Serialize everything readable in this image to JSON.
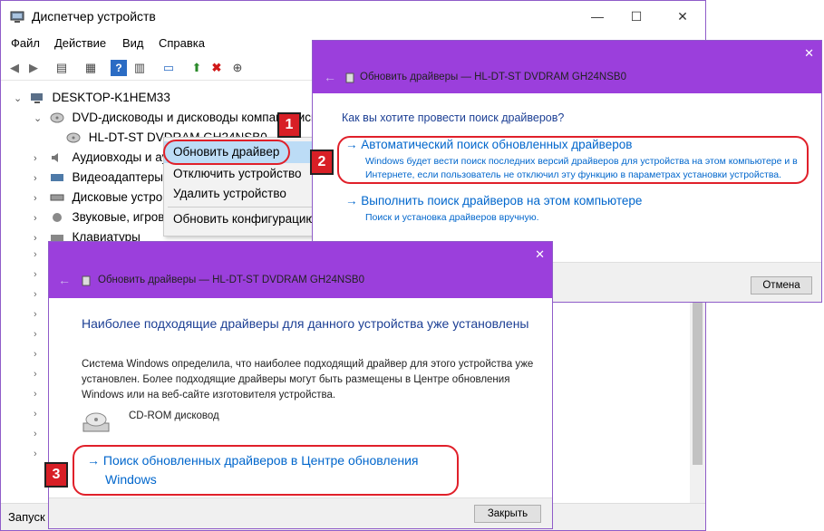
{
  "dm": {
    "title": "Диспетчер устройств",
    "minimize": "—",
    "maximize": "☐",
    "close": "✕",
    "menu": [
      "Файл",
      "Действие",
      "Вид",
      "Справка"
    ],
    "tree": {
      "root": "DESKTOP-K1HEM33",
      "dvd_category": "DVD-дисководы и дисководы компакт-дисков",
      "dvd_device": "HL-DT-ST DVDRAM GH24NSB0",
      "audio": "Аудиовходы и аудиовыходы",
      "video": "Видеоадаптеры",
      "disks": "Дисковые устройства",
      "sound": "Звуковые, игровые и видеоустройства",
      "keyboards": "Клавиатуры"
    },
    "status": "Запуск"
  },
  "context_menu": {
    "update": "Обновить драйвер",
    "disable": "Отключить устройство",
    "remove": "Удалить устройство",
    "scan": "Обновить конфигурацию"
  },
  "dialog1": {
    "close": "✕",
    "caption": "Обновить драйверы — HL-DT-ST DVDRAM GH24NSB0",
    "question": "Как вы хотите провести поиск драйверов?",
    "auto_title": "→ Автоматический поиск обновленных драйверов",
    "auto_desc_1": "Windows будет вести поиск последних версий драйверов для устройства на этом компьютере и в",
    "auto_desc_2": "Интернете, если пользователь не отключил эту функцию в параметрах установки устройства.",
    "manual_title": "→ Выполнить поиск драйверов на этом компьютере",
    "manual_desc": "Поиск и установка драйверов вручную.",
    "cancel": "Отмена"
  },
  "dialog2": {
    "close": "✕",
    "caption": "Обновить драйверы — HL-DT-ST DVDRAM GH24NSB0",
    "heading": "Наиболее подходящие драйверы для данного устройства уже установлены",
    "body_1": "Система Windows определила, что наиболее подходящий драйвер для этого устройства уже",
    "body_2": "установлен. Более подходящие драйверы могут быть размещены в Центре обновления",
    "body_3": "Windows или на веб-сайте изготовителя устройства.",
    "device": "CD-ROM дисковод",
    "wu_link_1": "→ Поиск обновленных драйверов в Центре обновления",
    "wu_link_2": "Windows",
    "close_button": "Закрыть"
  },
  "badges": [
    "1",
    "2",
    "3"
  ],
  "colors": {
    "accent_purple": "#9b3fdc",
    "link_blue": "#0066cc",
    "highlight_red": "#e0202a"
  }
}
